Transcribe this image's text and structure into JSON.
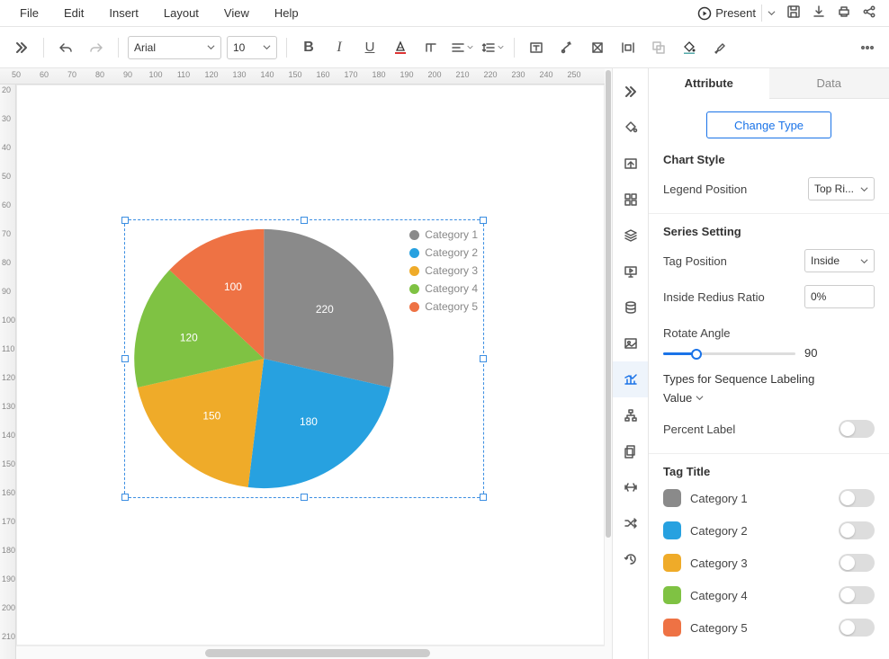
{
  "menu": {
    "items": [
      "File",
      "Edit",
      "Insert",
      "Layout",
      "View",
      "Help"
    ],
    "present": "Present"
  },
  "toolbar": {
    "font": "Arial",
    "size": "10"
  },
  "ruler_h": [
    50,
    60,
    70,
    80,
    90,
    100,
    110,
    120,
    130,
    140,
    150,
    160,
    170,
    180,
    190,
    200,
    210,
    220,
    230,
    240,
    250
  ],
  "ruler_v": [
    20,
    30,
    40,
    50,
    60,
    70,
    80,
    90,
    100,
    110,
    120,
    130,
    140,
    150,
    160,
    170,
    180,
    190,
    200,
    210
  ],
  "chart_data": {
    "type": "pie",
    "title": "",
    "series": [
      {
        "name": "Category 1",
        "value": 220,
        "color": "#8a8a8a"
      },
      {
        "name": "Category 2",
        "value": 180,
        "color": "#27a1e0"
      },
      {
        "name": "Category 3",
        "value": 150,
        "color": "#efab29"
      },
      {
        "name": "Category 4",
        "value": 120,
        "color": "#7fc243"
      },
      {
        "name": "Category 5",
        "value": 100,
        "color": "#ee7244"
      }
    ],
    "legend_position": "Top Right",
    "tag_position": "Inside",
    "inside_radius_ratio": "0%",
    "rotate_angle": 90,
    "sequence_label_type": "Value",
    "percent_label": false
  },
  "panel": {
    "tabs": {
      "attribute": "Attribute",
      "data": "Data"
    },
    "change_type": "Change Type",
    "chart_style": "Chart Style",
    "legend_position": "Legend Position",
    "legend_position_val": "Top Ri...",
    "series_setting": "Series Setting",
    "tag_position": "Tag Position",
    "tag_position_val": "Inside",
    "inside_radius": "Inside Redius Ratio",
    "rotate_angle": "Rotate Angle",
    "rotate_angle_val": "90",
    "types_seq": "Types for Sequence Labeling",
    "types_seq_val": "Value",
    "percent_label": "Percent Label",
    "tag_title": "Tag Title"
  }
}
